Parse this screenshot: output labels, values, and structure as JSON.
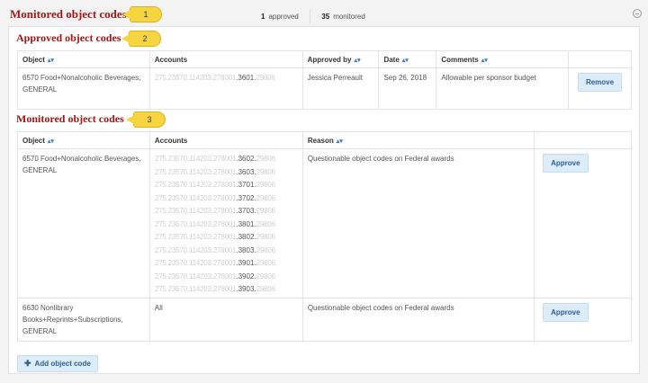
{
  "header": {
    "title": "Monitored object codes",
    "approved_count": "1",
    "approved_label": "approved",
    "monitored_count": "35",
    "monitored_label": "monitored"
  },
  "callouts": [
    "1",
    "2",
    "3"
  ],
  "approved": {
    "title": "Approved object codes",
    "columns": [
      "Object",
      "Accounts",
      "Approved by",
      "Date",
      "Comments"
    ],
    "rows": [
      {
        "object": "6570 Food+Nonalcoholic Beverages, GENERAL",
        "account_prefix": "275.23570.114203.278001",
        "account_suffix": ".3601.",
        "account_tail": "29806",
        "approved_by": "Jessica Perreault",
        "date": "Sep 26, 2018",
        "comment": "Allowable per sponsor budget",
        "action": "Remove"
      }
    ]
  },
  "monitored": {
    "title": "Monitored object codes",
    "columns": [
      "Object",
      "Accounts",
      "Reason"
    ],
    "rows": [
      {
        "object": "6570 Food+Nonalcoholic Beverages, GENERAL",
        "accounts": [
          {
            "prefix": "275.23570.114203.278001",
            "suffix": ".3602.",
            "tail": "29806"
          },
          {
            "prefix": "275.23570.114203.278001",
            "suffix": ".3603.",
            "tail": "29806"
          },
          {
            "prefix": "275.23570.114203.278001",
            "suffix": ".3701.",
            "tail": "29806"
          },
          {
            "prefix": "275.23570.114203.278001",
            "suffix": ".3702.",
            "tail": "29806"
          },
          {
            "prefix": "275.23570.114203.278001",
            "suffix": ".3703.",
            "tail": "29806"
          },
          {
            "prefix": "275.23570.114203.278001",
            "suffix": ".3801.",
            "tail": "29806"
          },
          {
            "prefix": "275.23570.114203.278001",
            "suffix": ".3802.",
            "tail": "29806"
          },
          {
            "prefix": "275.23570.114203.278001",
            "suffix": ".3803.",
            "tail": "29806"
          },
          {
            "prefix": "275.23570.114203.278001",
            "suffix": ".3901.",
            "tail": "29806"
          },
          {
            "prefix": "275.23570.114203.278001",
            "suffix": ".3902.",
            "tail": "29806"
          },
          {
            "prefix": "275.23570.114203.278001",
            "suffix": ".3903.",
            "tail": "29806"
          }
        ],
        "reason": "Questionable object codes on Federal awards",
        "action": "Approve"
      },
      {
        "object": "6630 Nonlibrary Books+Reprints+Subscriptions, GENERAL",
        "accounts_text": "All",
        "reason": "Questionable object codes on Federal awards",
        "action": "Approve"
      }
    ],
    "add_label": "Add object code"
  },
  "icons": {
    "sort": "sort-icon",
    "collapse": "collapse-icon",
    "add": "plus-icon"
  }
}
